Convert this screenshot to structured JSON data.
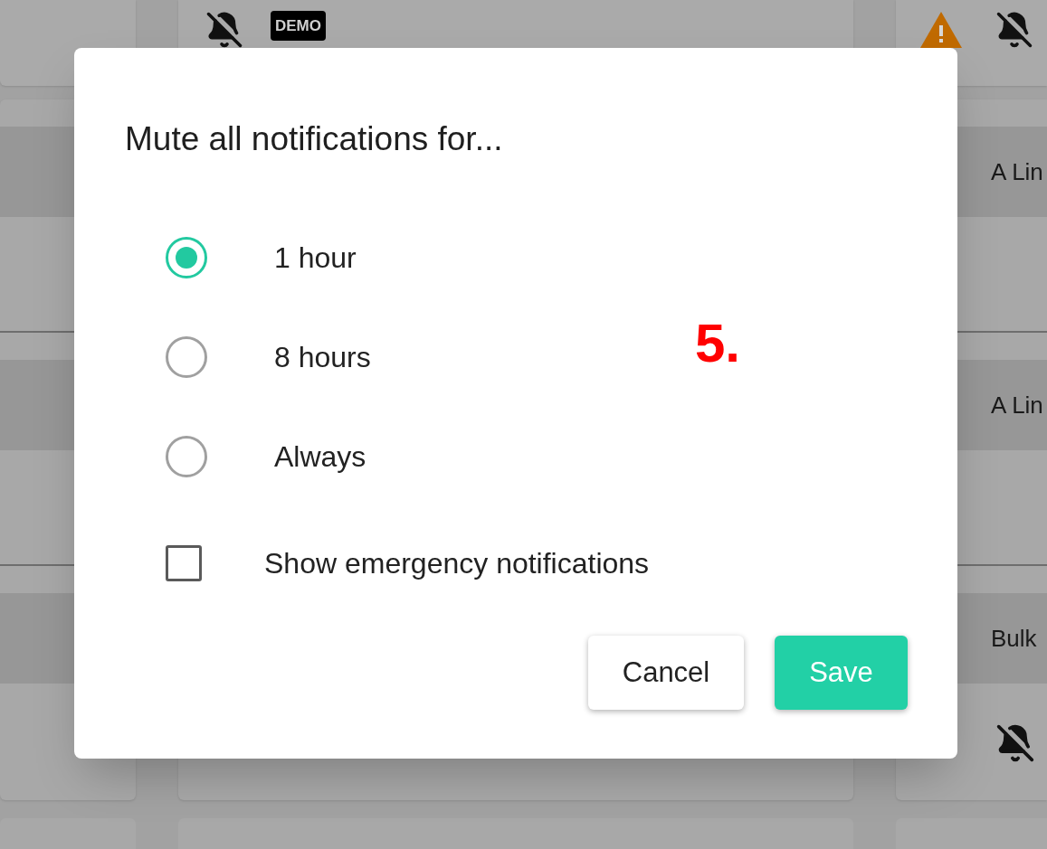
{
  "background": {
    "badge": "DEMO",
    "right_items": [
      {
        "title": "A Lin"
      },
      {
        "title": "A Lin"
      },
      {
        "title": "Bulk"
      }
    ]
  },
  "dialog": {
    "title": "Mute all notifications for...",
    "options": [
      {
        "label": "1 hour",
        "selected": true
      },
      {
        "label": "8 hours",
        "selected": false
      },
      {
        "label": "Always",
        "selected": false
      }
    ],
    "checkbox": {
      "label": "Show emergency notifications",
      "checked": false
    },
    "buttons": [
      {
        "label": "Cancel",
        "kind": "secondary"
      },
      {
        "label": "Save",
        "kind": "primary"
      }
    ]
  },
  "annotation": "5."
}
